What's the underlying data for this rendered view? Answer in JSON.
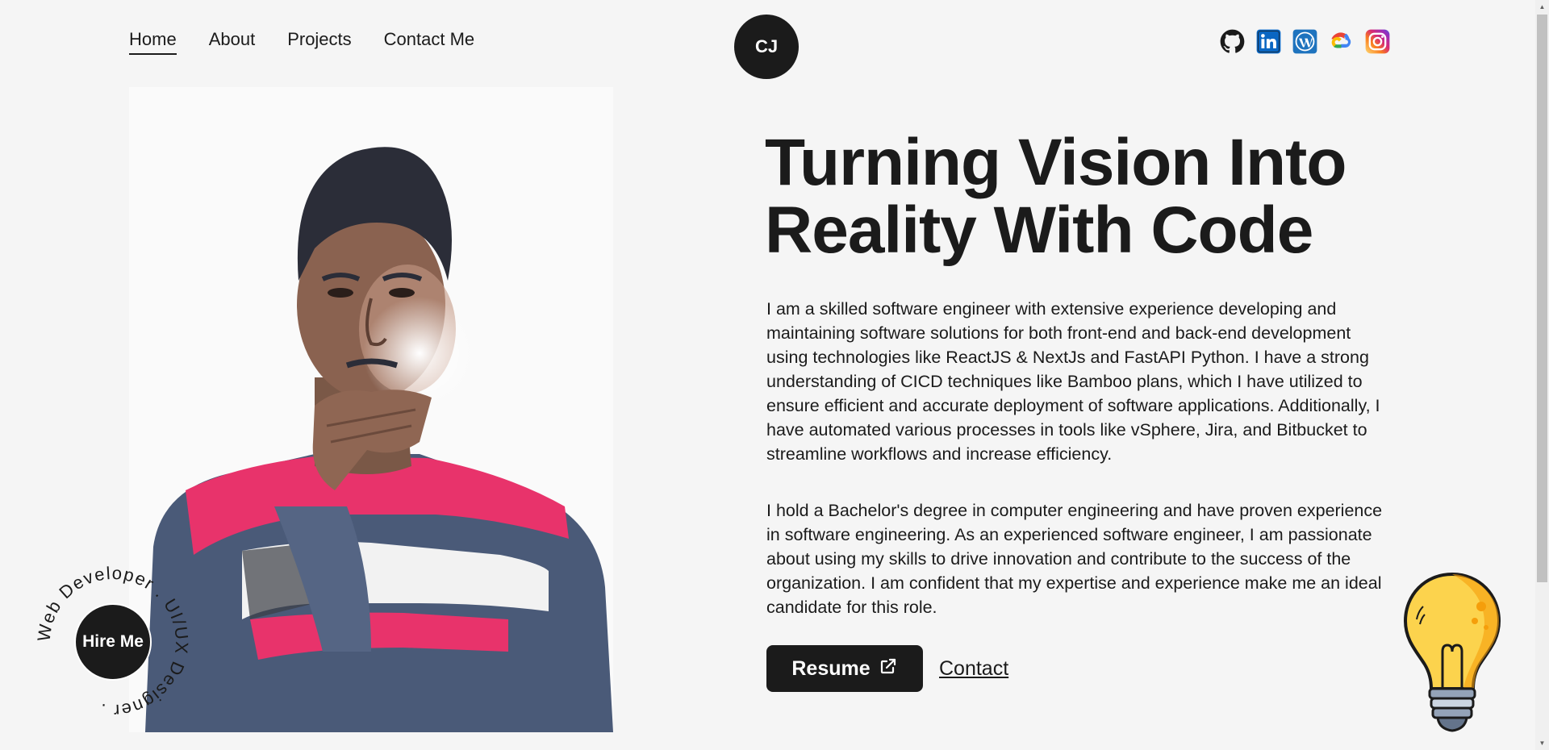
{
  "nav": {
    "items": [
      {
        "label": "Home",
        "active": true
      },
      {
        "label": "About",
        "active": false
      },
      {
        "label": "Projects",
        "active": false
      },
      {
        "label": "Contact Me",
        "active": false
      }
    ],
    "logo_text": "CJ",
    "social_icons": [
      "github-icon",
      "linkedin-icon",
      "wordpress-icon",
      "google-cloud-icon",
      "instagram-icon"
    ]
  },
  "hero": {
    "headline": "Turning Vision Into Reality With Code",
    "paragraph_1": "I am a skilled software engineer with extensive experience developing and maintaining software solutions for both front-end and back-end development using technologies like ReactJS & NextJs and FastAPI Python. I have a strong understanding of CICD techniques like Bamboo plans, which I have utilized to ensure efficient and accurate deployment of software applications. Additionally, I have automated various processes in tools like vSphere, Jira, and Bitbucket to streamline workflows and increase efficiency.",
    "paragraph_2": "I hold a Bachelor's degree in computer engineering and have proven experience in software engineering. As an experienced software engineer, I am passionate about using my skills to drive innovation and contribute to the success of the organization. I am confident that my expertise and experience make me an ideal candidate for this role.",
    "resume_label": "Resume",
    "contact_label": "Contact"
  },
  "hire_badge": {
    "button_label": "Hire Me",
    "ring_text": "Web Developer . UI/UX Designer ."
  },
  "colors": {
    "background": "#f5f5f5",
    "dark": "#1b1b1b",
    "text": "#1b1b1b",
    "shirt_pink": "#e8336b",
    "shirt_gray": "#4a5a78",
    "bulb_yellow": "#fcd34d"
  }
}
